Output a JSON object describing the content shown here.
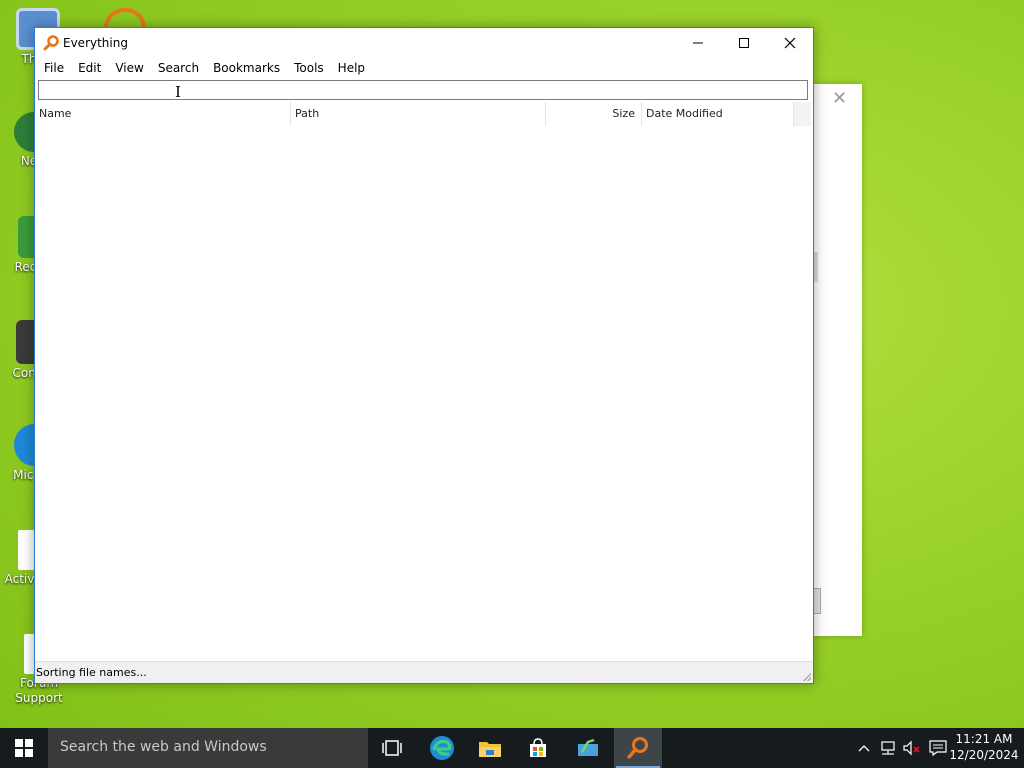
{
  "desktop": {
    "icons": [
      {
        "label": "Th"
      },
      {
        "label": "Ne"
      },
      {
        "label": "Recy"
      },
      {
        "label": "Contr"
      },
      {
        "label": "Mic E"
      },
      {
        "label": "Activa K"
      },
      {
        "label": "Forum Support"
      }
    ]
  },
  "window": {
    "title": "Everything",
    "menu": [
      "File",
      "Edit",
      "View",
      "Search",
      "Bookmarks",
      "Tools",
      "Help"
    ],
    "search": {
      "value": "",
      "placeholder": ""
    },
    "columns": [
      "Name",
      "Path",
      "Size",
      "Date Modified"
    ],
    "status": "Sorting file names..."
  },
  "taskbar": {
    "search_placeholder": "Search the web and Windows",
    "apps": [
      {
        "icon": "task-view-icon"
      },
      {
        "icon": "edge-icon"
      },
      {
        "icon": "file-explorer-icon"
      },
      {
        "icon": "store-icon"
      },
      {
        "icon": "sway-icon"
      },
      {
        "icon": "everything-search-icon"
      }
    ],
    "time": "11:21 AM",
    "date": "12/20/2024"
  },
  "colors": {
    "accent": "#2b7bd8",
    "everything_orange": "#e8761a",
    "taskbar": "#161b1e"
  }
}
